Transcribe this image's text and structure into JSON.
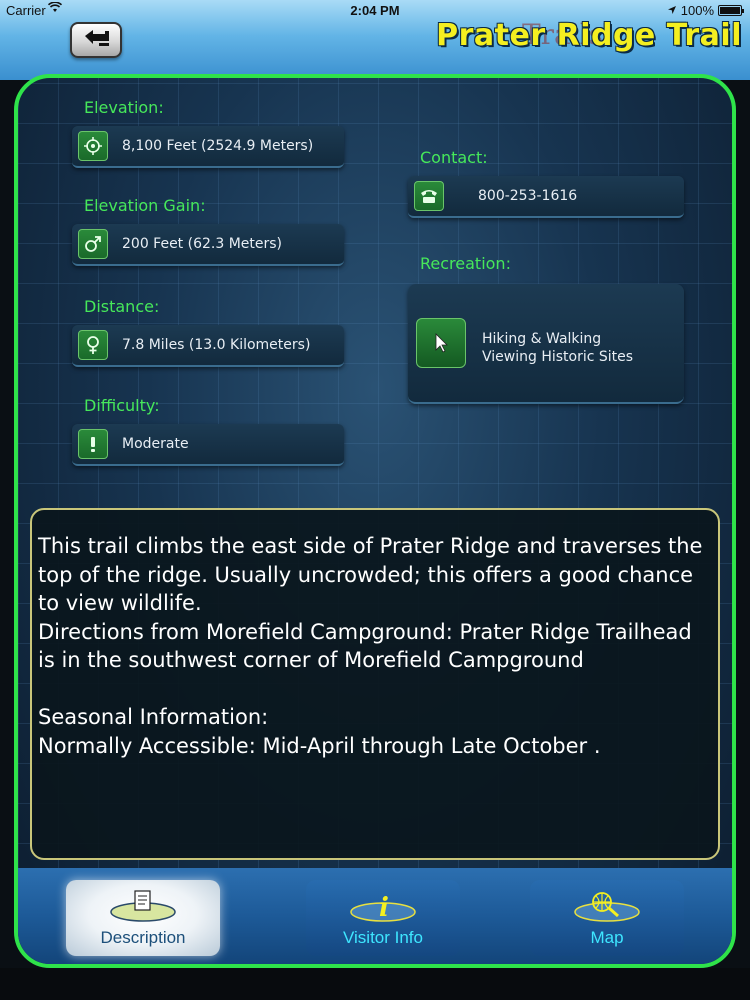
{
  "status_bar": {
    "carrier": "Carrier",
    "time": "2:04 PM",
    "battery": "100%"
  },
  "header": {
    "title": "Prater Ridge Trail",
    "back_icon": "back-arrow-icon",
    "ghost_text": "Trails"
  },
  "details": {
    "elevation": {
      "label": "Elevation:",
      "value": "8,100 Feet (2524.9 Meters)",
      "icon": "target-icon"
    },
    "elevation_gain": {
      "label": "Elevation  Gain:",
      "value": "200 Feet (62.3 Meters)",
      "icon": "male-symbol-icon"
    },
    "distance": {
      "label": "Distance:",
      "value": "7.8 Miles (13.0 Kilometers)",
      "icon": "female-symbol-icon"
    },
    "difficulty": {
      "label": "Difficulty:",
      "value": "Moderate",
      "icon": "exclamation-icon"
    },
    "contact": {
      "label": "Contact:",
      "value": "800-253-1616",
      "icon": "phone-icon"
    },
    "recreation": {
      "label": "Recreation:",
      "items": [
        "Hiking & Walking",
        "Viewing Historic Sites"
      ],
      "icon": "cursor-arrow-icon"
    }
  },
  "description": {
    "p1": "This trail climbs the east side of Prater Ridge and traverses the top of the ridge. Usually uncrowded; this offers a good chance to view wildlife.",
    "p2": "Directions from Morefield Campground: Prater Ridge Trailhead is in the southwest corner of Morefield Campground",
    "p3": "Seasonal Information:",
    "p4": "Normally Accessible: Mid-April through Late October ."
  },
  "tabs": [
    {
      "label": "Description",
      "icon": "document-icon",
      "active": true
    },
    {
      "label": "Visitor  Info",
      "icon": "info-icon",
      "active": false
    },
    {
      "label": "Map",
      "icon": "globe-magnifier-icon",
      "active": false
    }
  ],
  "colors": {
    "accent_green": "#2fe34a",
    "title_yellow": "#f4ef20",
    "tab_cyan": "#3ee6ff",
    "frame_border": "#2fe34a"
  }
}
